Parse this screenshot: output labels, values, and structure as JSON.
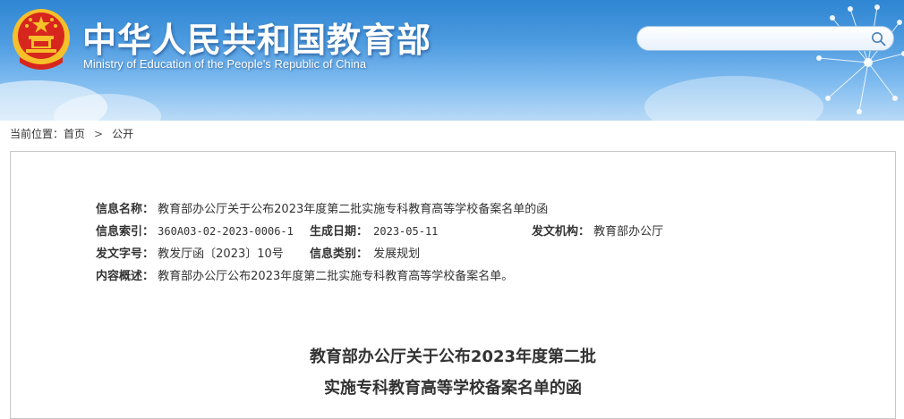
{
  "header": {
    "title": "中华人民共和国教育部",
    "subtitle": "Ministry of Education of the People's Republic of China",
    "search": {
      "placeholder": "",
      "value": ""
    },
    "icons": [
      "national-emblem-icon",
      "search-icon"
    ]
  },
  "breadcrumb": {
    "prefix": "当前位置：",
    "home": "首页",
    "separator": ">",
    "current": "公开"
  },
  "info": {
    "name_label": "信息名称：",
    "name_value": "教育部办公厅关于公布2023年度第二批实施专科教育高等学校备案名单的函",
    "index_label": "信息索引：",
    "index_value": "360A03-02-2023-0006-1",
    "date_label": "生成日期：",
    "date_value": "2023-05-11",
    "org_label": "发文机构：",
    "org_value": "教育部办公厅",
    "docno_label": "发文字号：",
    "docno_value": "教发厅函〔2023〕10号",
    "category_label": "信息类别：",
    "category_value": "发展规划",
    "summary_label": "内容概述：",
    "summary_value": "教育部办公厅公布2023年度第二批实施专科教育高等学校备案名单。"
  },
  "document": {
    "title_line1": "教育部办公厅关于公布2023年度第二批",
    "title_line2": "实施专科教育高等学校备案名单的函"
  },
  "colors": {
    "header_top": "#2f86d2",
    "header_bottom": "#b9daf6",
    "emblem_red": "#d7261e",
    "emblem_gold": "#f6c02a",
    "text": "#333333",
    "border": "#c8c8c8"
  }
}
